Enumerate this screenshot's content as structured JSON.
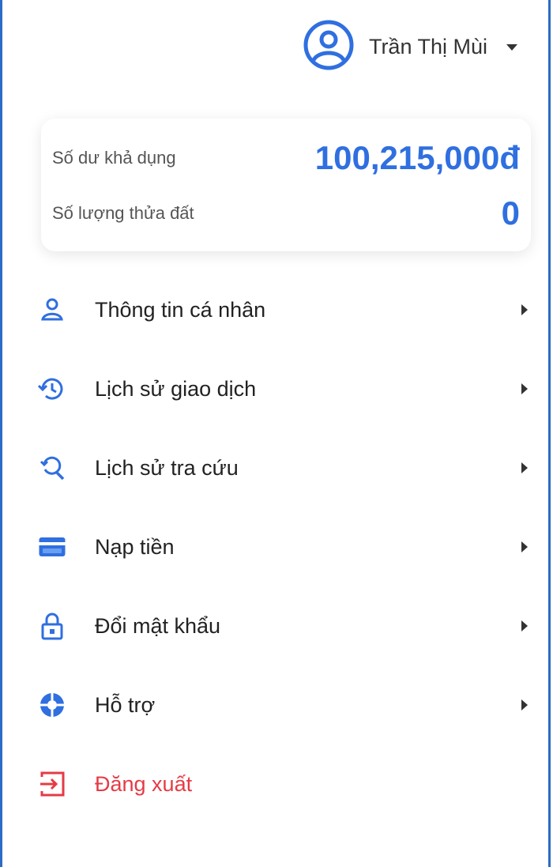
{
  "user": {
    "name": "Trần Thị Mùi",
    "menu_icon": "chevron-down-icon",
    "avatar_icon": "user-circle-icon"
  },
  "balance": {
    "available_label": "Số dư khả dụng",
    "available_value": "100,215,000đ",
    "parcels_label": "Số lượng thửa đất",
    "parcels_value": "0"
  },
  "menu": {
    "items": [
      {
        "label": "Thông tin cá nhân",
        "icon": "user-icon"
      },
      {
        "label": "Lịch sử giao dịch",
        "icon": "history-icon"
      },
      {
        "label": "Lịch sử tra cứu",
        "icon": "search-history-icon"
      },
      {
        "label": "Nạp tiền",
        "icon": "card-icon"
      },
      {
        "label": "Đổi mật khẩu",
        "icon": "lock-icon"
      },
      {
        "label": "Hỗ trợ",
        "icon": "support-icon"
      }
    ],
    "logout": {
      "label": "Đăng xuất",
      "icon": "logout-icon"
    }
  },
  "colors": {
    "accent": "#2f6fe0",
    "danger": "#e53b45",
    "border": "#2b6cc4"
  }
}
